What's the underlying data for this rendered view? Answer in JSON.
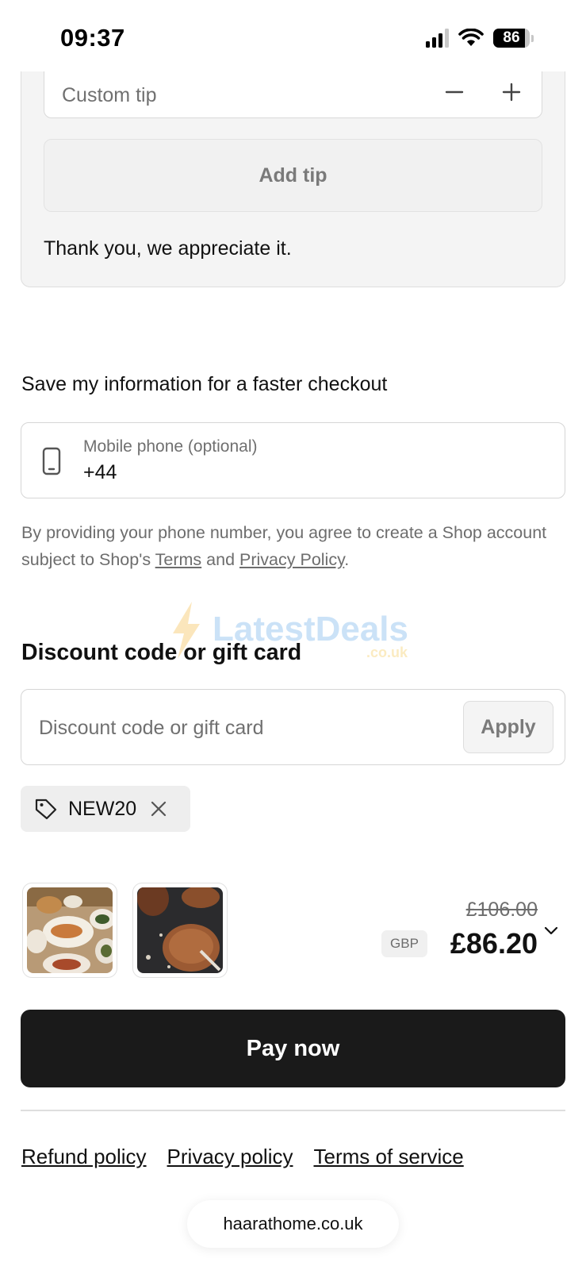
{
  "status_bar": {
    "time": "09:37",
    "battery": "86",
    "battery_level": 0.86
  },
  "tip": {
    "custom_placeholder": "Custom tip",
    "add_button": "Add tip",
    "thanks": "Thank you, we appreciate it."
  },
  "save_info": {
    "heading": "Save my information for a faster checkout",
    "phone_label": "Mobile phone (optional)",
    "phone_value": "+44",
    "consent_prefix": "By providing your phone number, you agree to create a Shop account subject to Shop's ",
    "terms_link": "Terms",
    "consent_and": " and ",
    "privacy_link": "Privacy Policy",
    "consent_suffix": "."
  },
  "watermark": {
    "text": "LatestDeals",
    "sub": ".co.uk"
  },
  "discount": {
    "heading": "Discount code or gift card",
    "placeholder": "Discount code or gift card",
    "apply_button": "Apply",
    "applied_code": "NEW20"
  },
  "summary": {
    "old_price": "£106.00",
    "currency": "GBP",
    "total": "£86.20"
  },
  "pay_button": "Pay now",
  "footer": {
    "links": [
      "Refund policy",
      "Privacy policy",
      "Terms of service"
    ],
    "domain": "haarathome.co.uk"
  },
  "icons": {
    "status": [
      "signal-icon",
      "wifi-icon",
      "battery-icon"
    ],
    "tip": [
      "minus-icon",
      "plus-icon"
    ],
    "phone": "mobile-phone-icon",
    "chip": [
      "tag-icon",
      "close-icon"
    ],
    "summary": "chevron-down-icon"
  },
  "colors": {
    "primary_button": "#1a1a1a",
    "card_bg": "#f4f4f4"
  }
}
